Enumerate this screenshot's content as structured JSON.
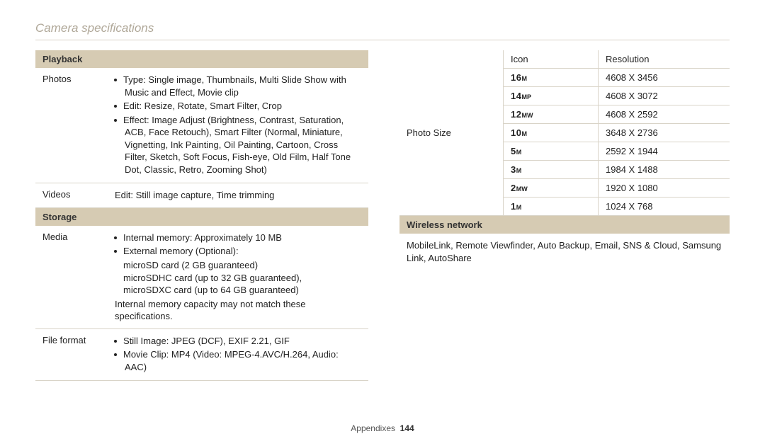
{
  "title": "Camera specifications",
  "footer": {
    "section": "Appendixes",
    "page": "144"
  },
  "left": {
    "sections": [
      {
        "header": "Playback",
        "rows": [
          {
            "label": "Photos",
            "bullets": [
              "Type: Single image, Thumbnails, Multi Slide Show with Music and Effect, Movie clip",
              "Edit: Resize, Rotate, Smart Filter, Crop",
              "Effect: Image Adjust (Brightness, Contrast, Saturation, ACB, Face Retouch), Smart Filter (Normal, Miniature, Vignetting, Ink Painting, Oil Painting, Cartoon, Cross Filter, Sketch, Soft Focus, Fish-eye, Old Film, Half Tone Dot, Classic, Retro, Zooming Shot)"
            ]
          },
          {
            "label": "Videos",
            "text": "Edit: Still image capture, Time trimming"
          }
        ]
      },
      {
        "header": "Storage",
        "rows": [
          {
            "label": "Media",
            "bullets": [
              "Internal memory: Approximately 10 MB",
              "External memory (Optional):"
            ],
            "sublines": [
              "microSD card (2 GB guaranteed)",
              "microSDHC card (up to 32 GB guaranteed),",
              "microSDXC card (up to 64 GB guaranteed)"
            ],
            "note": "Internal memory capacity may not match these specifications."
          },
          {
            "label": "File format",
            "bullets": [
              "Still Image: JPEG (DCF), EXIF 2.21, GIF",
              "Movie Clip: MP4 (Video: MPEG-4.AVC/H.264, Audio: AAC)"
            ]
          }
        ]
      }
    ]
  },
  "right": {
    "photo_size": {
      "label": "Photo Size",
      "head": {
        "icon": "Icon",
        "resolution": "Resolution"
      },
      "rows": [
        {
          "icon_num": "16",
          "icon_suf": "M",
          "res": "4608 X 3456"
        },
        {
          "icon_num": "14",
          "icon_suf": "MP",
          "res": "4608 X 3072"
        },
        {
          "icon_num": "12",
          "icon_suf": "MW",
          "res": "4608 X 2592"
        },
        {
          "icon_num": "10",
          "icon_suf": "M",
          "res": "3648 X 2736"
        },
        {
          "icon_num": "5",
          "icon_suf": "M",
          "res": "2592 X 1944"
        },
        {
          "icon_num": "3",
          "icon_suf": "M",
          "res": "1984 X 1488"
        },
        {
          "icon_num": "2",
          "icon_suf": "MW",
          "res": "1920 X 1080"
        },
        {
          "icon_num": "1",
          "icon_suf": "M",
          "res": "1024 X 768"
        }
      ]
    },
    "wireless": {
      "header": "Wireless network",
      "text": "MobileLink, Remote Viewfinder, Auto Backup, Email, SNS & Cloud, Samsung Link, AutoShare"
    }
  }
}
